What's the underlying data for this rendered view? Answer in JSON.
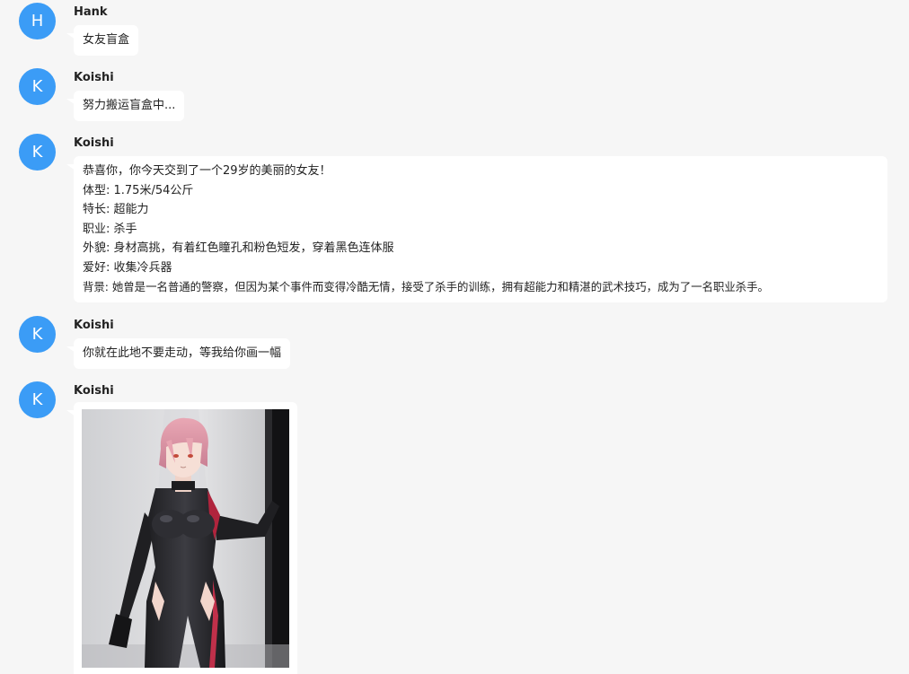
{
  "messages": [
    {
      "sender": "Hank",
      "avatar_letter": "H",
      "text": "女友盲盒"
    },
    {
      "sender": "Koishi",
      "avatar_letter": "K",
      "text": "努力搬运盲盒中..."
    },
    {
      "sender": "Koishi",
      "avatar_letter": "K",
      "lines": [
        "恭喜你，你今天交到了一个29岁的美丽的女友！",
        "体型: 1.75米/54公斤",
        "特长: 超能力",
        "职业: 杀手",
        "外貌: 身材高挑，有着红色瞳孔和粉色短发，穿着黑色连体服",
        "爱好: 收集冷兵器",
        "背景: 她曾是一名普通的警察，但因为某个事件而变得冷酷无情，接受了杀手的训练，拥有超能力和精湛的武术技巧，成为了一名职业杀手。"
      ]
    },
    {
      "sender": "Koishi",
      "avatar_letter": "K",
      "text": "你就在此地不要走动，等我给你画一幅"
    },
    {
      "sender": "Koishi",
      "avatar_letter": "K",
      "image": "generated-anime-portrait"
    }
  ],
  "colors": {
    "background": "#f6f6f6",
    "avatar": "#3b9cf6",
    "bubble": "#ffffff",
    "text": "#222222"
  }
}
